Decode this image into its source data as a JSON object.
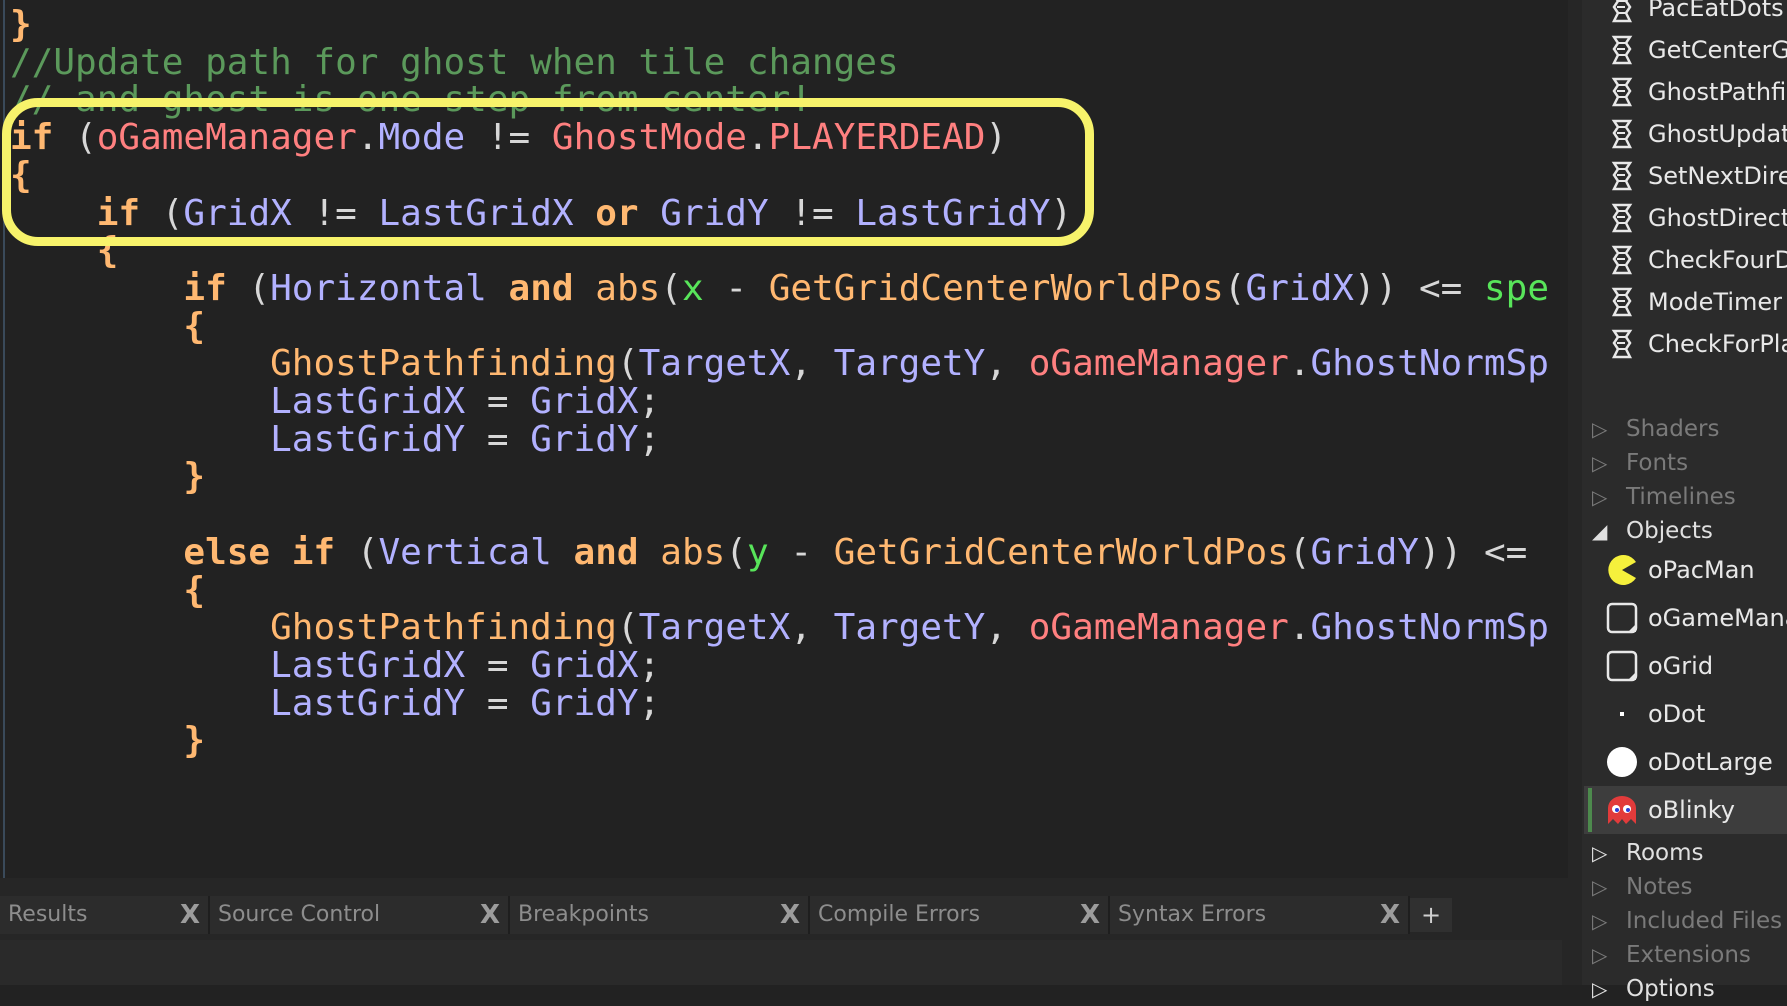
{
  "code": {
    "lines": [
      [
        {
          "t": "}",
          "c": "kw"
        }
      ],
      [
        {
          "t": "//Update path for ghost when tile changes",
          "c": "cmt"
        }
      ],
      [
        {
          "t": "// and ghost is one step from center!",
          "c": "cmt"
        }
      ],
      [
        {
          "t": "if",
          "c": "kw"
        },
        {
          "t": " (",
          "c": "op"
        },
        {
          "t": "oGameManager",
          "c": "obj"
        },
        {
          "t": ".",
          "c": "op"
        },
        {
          "t": "Mode",
          "c": "var"
        },
        {
          "t": " != ",
          "c": "op"
        },
        {
          "t": "GhostMode",
          "c": "obj"
        },
        {
          "t": ".",
          "c": "op"
        },
        {
          "t": "PLAYERDEAD",
          "c": "obj"
        },
        {
          "t": ")",
          "c": "op"
        }
      ],
      [
        {
          "t": "{",
          "c": "kw"
        }
      ],
      [
        {
          "t": "    ",
          "c": "op"
        },
        {
          "t": "if",
          "c": "kw"
        },
        {
          "t": " (",
          "c": "op"
        },
        {
          "t": "GridX",
          "c": "var"
        },
        {
          "t": " != ",
          "c": "op"
        },
        {
          "t": "LastGridX",
          "c": "var"
        },
        {
          "t": " or ",
          "c": "kw"
        },
        {
          "t": "GridY",
          "c": "var"
        },
        {
          "t": " != ",
          "c": "op"
        },
        {
          "t": "LastGridY",
          "c": "var"
        },
        {
          "t": ")",
          "c": "op"
        }
      ],
      [
        {
          "t": "    ",
          "c": "op"
        },
        {
          "t": "{",
          "c": "kw"
        }
      ],
      [
        {
          "t": "        ",
          "c": "op"
        },
        {
          "t": "if",
          "c": "kw"
        },
        {
          "t": " (",
          "c": "op"
        },
        {
          "t": "Horizontal",
          "c": "var"
        },
        {
          "t": " ",
          "c": "op"
        },
        {
          "t": "and",
          "c": "kw"
        },
        {
          "t": " ",
          "c": "op"
        },
        {
          "t": "abs",
          "c": "fn"
        },
        {
          "t": "(",
          "c": "op"
        },
        {
          "t": "x",
          "c": "bi"
        },
        {
          "t": " - ",
          "c": "op"
        },
        {
          "t": "GetGridCenterWorldPos",
          "c": "fn"
        },
        {
          "t": "(",
          "c": "op"
        },
        {
          "t": "GridX",
          "c": "var"
        },
        {
          "t": ")) <= ",
          "c": "op"
        },
        {
          "t": "spe",
          "c": "bi"
        }
      ],
      [
        {
          "t": "        ",
          "c": "op"
        },
        {
          "t": "{",
          "c": "kw"
        }
      ],
      [
        {
          "t": "            ",
          "c": "op"
        },
        {
          "t": "GhostPathfinding",
          "c": "fn"
        },
        {
          "t": "(",
          "c": "op"
        },
        {
          "t": "TargetX",
          "c": "var"
        },
        {
          "t": ", ",
          "c": "op"
        },
        {
          "t": "TargetY",
          "c": "var"
        },
        {
          "t": ", ",
          "c": "op"
        },
        {
          "t": "oGameManager",
          "c": "obj"
        },
        {
          "t": ".",
          "c": "op"
        },
        {
          "t": "GhostNormSp",
          "c": "var"
        }
      ],
      [
        {
          "t": "            ",
          "c": "op"
        },
        {
          "t": "LastGridX",
          "c": "var"
        },
        {
          "t": " = ",
          "c": "op"
        },
        {
          "t": "GridX",
          "c": "var"
        },
        {
          "t": ";",
          "c": "op"
        }
      ],
      [
        {
          "t": "            ",
          "c": "op"
        },
        {
          "t": "LastGridY",
          "c": "var"
        },
        {
          "t": " = ",
          "c": "op"
        },
        {
          "t": "GridY",
          "c": "var"
        },
        {
          "t": ";",
          "c": "op"
        }
      ],
      [
        {
          "t": "        ",
          "c": "op"
        },
        {
          "t": "}",
          "c": "kw"
        }
      ],
      [],
      [
        {
          "t": "        ",
          "c": "op"
        },
        {
          "t": "else if",
          "c": "kw"
        },
        {
          "t": " (",
          "c": "op"
        },
        {
          "t": "Vertical",
          "c": "var"
        },
        {
          "t": " ",
          "c": "op"
        },
        {
          "t": "and",
          "c": "kw"
        },
        {
          "t": " ",
          "c": "op"
        },
        {
          "t": "abs",
          "c": "fn"
        },
        {
          "t": "(",
          "c": "op"
        },
        {
          "t": "y",
          "c": "bi"
        },
        {
          "t": " - ",
          "c": "op"
        },
        {
          "t": "GetGridCenterWorldPos",
          "c": "fn"
        },
        {
          "t": "(",
          "c": "op"
        },
        {
          "t": "GridY",
          "c": "var"
        },
        {
          "t": ")) <=",
          "c": "op"
        }
      ],
      [
        {
          "t": "        ",
          "c": "op"
        },
        {
          "t": "{",
          "c": "kw"
        }
      ],
      [
        {
          "t": "            ",
          "c": "op"
        },
        {
          "t": "GhostPathfinding",
          "c": "fn"
        },
        {
          "t": "(",
          "c": "op"
        },
        {
          "t": "TargetX",
          "c": "var"
        },
        {
          "t": ", ",
          "c": "op"
        },
        {
          "t": "TargetY",
          "c": "var"
        },
        {
          "t": ", ",
          "c": "op"
        },
        {
          "t": "oGameManager",
          "c": "obj"
        },
        {
          "t": ".",
          "c": "op"
        },
        {
          "t": "GhostNormSp",
          "c": "var"
        }
      ],
      [
        {
          "t": "            ",
          "c": "op"
        },
        {
          "t": "LastGridX",
          "c": "var"
        },
        {
          "t": " = ",
          "c": "op"
        },
        {
          "t": "GridX",
          "c": "var"
        },
        {
          "t": ";",
          "c": "op"
        }
      ],
      [
        {
          "t": "            ",
          "c": "op"
        },
        {
          "t": "LastGridY",
          "c": "var"
        },
        {
          "t": " = ",
          "c": "op"
        },
        {
          "t": "GridY",
          "c": "var"
        },
        {
          "t": ";",
          "c": "op"
        }
      ],
      [
        {
          "t": "        ",
          "c": "op"
        },
        {
          "t": "}",
          "c": "kw"
        }
      ]
    ]
  },
  "resource_tree": {
    "scripts": [
      "PacEatDots",
      "GetCenterGr",
      "GhostPathfir",
      "GhostUpdate",
      "SetNextDirec",
      "GhostDirecti",
      "CheckFourD",
      "ModeTimer",
      "CheckForPla"
    ],
    "folders_top": [
      {
        "label": "Shaders",
        "state": "collapsed",
        "dim": true
      },
      {
        "label": "Fonts",
        "state": "collapsed",
        "dim": true
      },
      {
        "label": "Timelines",
        "state": "collapsed",
        "dim": true
      },
      {
        "label": "Objects",
        "state": "expanded",
        "dim": false
      }
    ],
    "objects": [
      {
        "label": "oPacMan",
        "icon": "pacman-icon"
      },
      {
        "label": "oGameMana",
        "icon": "object-icon"
      },
      {
        "label": "oGrid",
        "icon": "object-icon"
      },
      {
        "label": "oDot",
        "icon": "dot-icon"
      },
      {
        "label": "oDotLarge",
        "icon": "large-dot-icon"
      },
      {
        "label": "oBlinky",
        "icon": "ghost-icon",
        "selected": true
      }
    ],
    "folders_bottom": [
      {
        "label": "Rooms",
        "state": "collapsed",
        "dim": false
      },
      {
        "label": "Notes",
        "state": "collapsed",
        "dim": true
      },
      {
        "label": "Included Files",
        "state": "collapsed",
        "dim": true
      },
      {
        "label": "Extensions",
        "state": "collapsed",
        "dim": true
      },
      {
        "label": "Options",
        "state": "collapsed",
        "dim": false
      }
    ]
  },
  "bottom_tabs": [
    {
      "label": "Results",
      "close": "X"
    },
    {
      "label": "Source Control",
      "close": "X"
    },
    {
      "label": "Breakpoints",
      "close": "X"
    },
    {
      "label": "Compile Errors",
      "close": "X"
    },
    {
      "label": "Syntax Errors",
      "close": "X"
    }
  ],
  "add_tab_label": "+",
  "colors": {
    "keyword": "#ffb871",
    "variable": "#b2b1ff",
    "object": "#ff8080",
    "comment": "#5b995b",
    "builtin": "#58e55a",
    "highlight": "#f7f36b"
  }
}
